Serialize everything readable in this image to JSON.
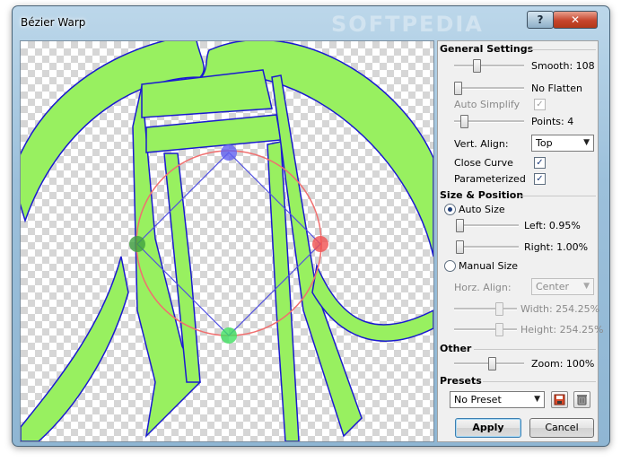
{
  "window": {
    "title": "Bézier Warp",
    "watermark": "SOFTPEDIA",
    "help_label": "?",
    "close_label": "✕"
  },
  "general": {
    "heading": "General Settings",
    "smooth_label": "Smooth: 108",
    "smooth_level": 0.3,
    "flatten_label": "No Flatten",
    "flatten_level": 0.0,
    "auto_simplify_label": "Auto Simplify",
    "auto_simplify_checked": true,
    "points_label": "Points: 4",
    "points_level": 0.1,
    "vert_align_label": "Vert. Align:",
    "vert_align_value": "Top",
    "close_curve_label": "Close Curve",
    "close_curve_checked": true,
    "parameterized_label": "Parameterized",
    "parameterized_checked": true
  },
  "size_position": {
    "heading": "Size & Position",
    "auto_size_label": "Auto Size",
    "left_label": "Left: 0.95%",
    "left_level": 0.0,
    "right_label": "Right: 1.00%",
    "right_level": 0.0,
    "manual_size_label": "Manual Size",
    "horz_align_label": "Horz. Align:",
    "horz_align_value": "Center",
    "width_label": "Width: 254.25%",
    "width_level": 0.75,
    "height_label": "Height: 254.25%",
    "height_level": 0.75
  },
  "other": {
    "heading": "Other",
    "zoom_label": "Zoom: 100%",
    "zoom_level": 0.55
  },
  "presets": {
    "heading": "Presets",
    "selected": "No Preset"
  },
  "buttons": {
    "apply": "Apply",
    "cancel": "Cancel"
  },
  "icons": {
    "save": "save-icon",
    "delete": "trash-icon",
    "check": "✓",
    "dropdown": "▼"
  },
  "colors": {
    "shape_fill": "#98f060",
    "shape_stroke": "#1a1ad0",
    "circle": "#f07070",
    "diamond": "#5050e0",
    "handle_top": "#6060f0",
    "handle_left": "#40a040",
    "handle_right": "#f05050",
    "handle_bottom": "#40e060"
  }
}
